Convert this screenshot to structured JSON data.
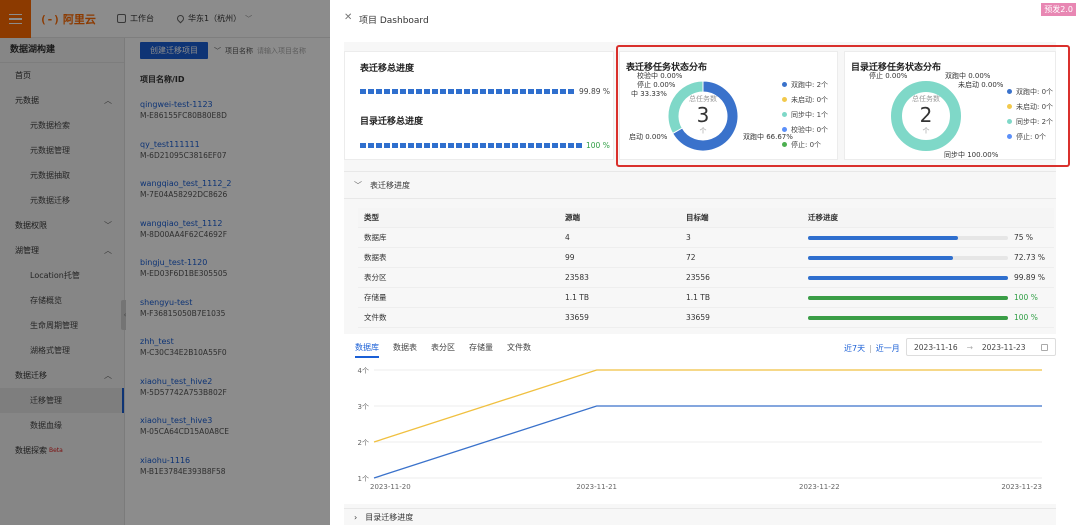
{
  "topbar": {
    "logo_mark": "(-)",
    "logo_text": "阿里云",
    "workbench": "工作台",
    "region": "华东1（杭州）"
  },
  "sidebar": {
    "title": "数据湖构建",
    "items": [
      {
        "label": "首页",
        "level": 0
      },
      {
        "label": "元数据",
        "level": 0,
        "caret": "︿"
      },
      {
        "label": "元数据检索",
        "level": 1
      },
      {
        "label": "元数据管理",
        "level": 1
      },
      {
        "label": "元数据抽取",
        "level": 1
      },
      {
        "label": "元数据迁移",
        "level": 1
      },
      {
        "label": "数据权限",
        "level": 0,
        "caret": "﹀"
      },
      {
        "label": "湖管理",
        "level": 0,
        "caret": "︿"
      },
      {
        "label": "Location托管",
        "level": 1
      },
      {
        "label": "存储概览",
        "level": 1
      },
      {
        "label": "生命周期管理",
        "level": 1
      },
      {
        "label": "湖格式管理",
        "level": 1
      },
      {
        "label": "数据迁移",
        "level": 0,
        "caret": "︿"
      },
      {
        "label": "迁移管理",
        "level": 1,
        "active": true
      },
      {
        "label": "数据血缘",
        "level": 1
      },
      {
        "label": "数据探索",
        "level": 0,
        "beta": "Beta"
      }
    ]
  },
  "project_list": {
    "create_button": "创建迁移项目",
    "filter_label": "项目名称",
    "filter_placeholder": "请输入项目名称",
    "column_header": "项目名称/ID",
    "rows": [
      {
        "name": "qingwei-test-1123",
        "id": "M-E86155FC80B80E8D"
      },
      {
        "name": "qy_test111111",
        "id": "M-6D21095C3816EF07"
      },
      {
        "name": "wangqiao_test_1112_2",
        "id": "M-7E04A58292DC8626"
      },
      {
        "name": "wangqiao_test_1112",
        "id": "M-8D00AA4F62C4692F"
      },
      {
        "name": "bingju_test-1120",
        "id": "M-ED03F6D1BE305505"
      },
      {
        "name": "shengyu-test",
        "id": "M-F36815050B7E1035"
      },
      {
        "name": "zhh_test",
        "id": "M-C30C34E2B10A55F0"
      },
      {
        "name": "xiaohu_test_hive2",
        "id": "M-5D57742A753B802F"
      },
      {
        "name": "xiaohu_test_hive3",
        "id": "M-05CA64CD15A0A8CE"
      },
      {
        "name": "xiaohu-1116",
        "id": "M-B1E3784E393B8F58"
      }
    ]
  },
  "drawer": {
    "title": "项目 Dashboard",
    "badge": "预发2.0",
    "table_progress": {
      "title": "表迁移总进度",
      "value": "99.89 %",
      "percent": 99.89
    },
    "dir_progress": {
      "title": "目录迁移总进度",
      "value": "100 %",
      "percent": 100
    },
    "table_status": {
      "title": "表迁移任务状态分布",
      "center_label": "总任务数",
      "center_value": "3",
      "center_unit": "个",
      "annotations": [
        "校验中 0.00%",
        "停止 0.00%",
        "中 33.33%",
        "启动 0.00%",
        "双跑中 66.67%"
      ],
      "legend": [
        {
          "label": "双跑中: 2个",
          "color": "#3a72cb"
        },
        {
          "label": "未启动: 0个",
          "color": "#f2c94c"
        },
        {
          "label": "同步中: 1个",
          "color": "#7fd8c8"
        },
        {
          "label": "校验中: 0个",
          "color": "#5b8ff9"
        },
        {
          "label": "停止: 0个",
          "color": "#4caf50"
        }
      ],
      "slices": [
        {
          "name": "双跑中",
          "value": 66.67,
          "color": "#3a72cb"
        },
        {
          "name": "同步中",
          "value": 33.33,
          "color": "#7fd8c8"
        }
      ]
    },
    "dir_status": {
      "title": "目录迁移任务状态分布",
      "center_label": "总任务数",
      "center_value": "2",
      "center_unit": "个",
      "annotations": [
        "停止 0.00%",
        "双跑中 0.00%",
        "未启动 0.00%",
        "同步中 100.00%"
      ],
      "legend": [
        {
          "label": "双跑中: 0个",
          "color": "#3a72cb"
        },
        {
          "label": "未启动: 0个",
          "color": "#f2c94c"
        },
        {
          "label": "同步中: 2个",
          "color": "#7fd8c8"
        },
        {
          "label": "停止: 0个",
          "color": "#5b8ff9"
        }
      ],
      "slices": [
        {
          "name": "同步中",
          "value": 100,
          "color": "#7fd8c8"
        }
      ]
    },
    "table_section": {
      "title": "表迁移进度",
      "headers": [
        "类型",
        "源端",
        "目标端",
        "迁移进度"
      ],
      "rows": [
        {
          "type": "数据库",
          "src": "4",
          "dst": "3",
          "progress": "75 %",
          "percent": 75,
          "color": "#2f6fce"
        },
        {
          "type": "数据表",
          "src": "99",
          "dst": "72",
          "progress": "72.73 %",
          "percent": 72.73,
          "color": "#2f6fce"
        },
        {
          "type": "表分区",
          "src": "23583",
          "dst": "23556",
          "progress": "99.89 %",
          "percent": 99.89,
          "color": "#2f6fce"
        },
        {
          "type": "存储量",
          "src": "1.1 TB",
          "dst": "1.1 TB",
          "progress": "100 %",
          "percent": 100,
          "color": "#3a9d46"
        },
        {
          "type": "文件数",
          "src": "33659",
          "dst": "33659",
          "progress": "100 %",
          "percent": 100,
          "color": "#3a9d46"
        }
      ]
    },
    "trend": {
      "tabs": [
        "数据库",
        "数据表",
        "表分区",
        "存储量",
        "文件数"
      ],
      "range_7d": "近7天",
      "range_1m": "近一月",
      "date_start": "2023-11-16",
      "date_arrow": "→",
      "date_end": "2023-11-23"
    },
    "dir_section": {
      "title": "目录迁移进度"
    }
  },
  "chart_data": {
    "type": "line",
    "x": [
      "2023-11-20",
      "2023-11-21",
      "2023-11-22",
      "2023-11-23"
    ],
    "yticks": [
      "1个",
      "2个",
      "3个",
      "4个"
    ],
    "ylim": [
      1,
      4
    ],
    "series": [
      {
        "values": [
          2,
          4,
          4,
          4
        ],
        "color": "#f0c040"
      },
      {
        "values": [
          1,
          3,
          3,
          3
        ],
        "color": "#3a72cb"
      }
    ],
    "grid": true
  }
}
